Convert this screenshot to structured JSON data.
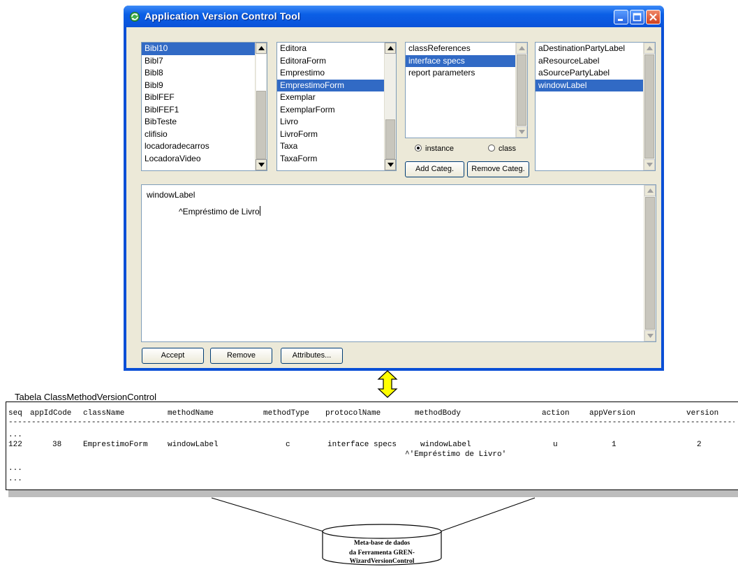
{
  "window": {
    "title": "Application Version Control Tool",
    "app_icon": "recycle-gear-icon",
    "controls": [
      "minimize-icon",
      "maximize-icon",
      "close-icon"
    ]
  },
  "lists": {
    "apps": {
      "items": [
        "Bibl10",
        "Bibl7",
        "Bibl8",
        "Bibl9",
        "BiblFEF",
        "BiblFEF1",
        "BibTeste",
        "clifisio",
        "locadoradecarros",
        "LocadoraVideo"
      ],
      "selected": "Bibl10"
    },
    "classes": {
      "items": [
        "Editora",
        "EditoraForm",
        "Emprestimo",
        "EmprestimoForm",
        "Exemplar",
        "ExemplarForm",
        "Livro",
        "LivroForm",
        "Taxa",
        "TaxaForm"
      ],
      "selected": "EmprestimoForm"
    },
    "categories": {
      "items": [
        "classReferences",
        "interface specs",
        "report parameters"
      ],
      "selected": "interface specs"
    },
    "methods": {
      "items": [
        "aDestinationPartyLabel",
        "aResourceLabel",
        "aSourcePartyLabel",
        "windowLabel"
      ],
      "selected": "windowLabel"
    }
  },
  "radios": {
    "instance_label": "instance",
    "class_label": "class",
    "selected": "instance"
  },
  "buttons": {
    "add_categ": "Add Categ.",
    "remove_categ": "Remove Categ.",
    "accept": "Accept",
    "remove": "Remove",
    "attributes": "Attributes..."
  },
  "editor": {
    "line1": "windowLabel",
    "line2": "^Empréstimo de Livro"
  },
  "table": {
    "caption": "Tabela ClassMethodVersionControl",
    "columns": [
      "seq",
      "appIdCode",
      "className",
      "methodName",
      "methodType",
      "protocolName",
      "methodBody",
      "action",
      "appVersion",
      "version"
    ],
    "separator": "-------------------------------------------------------------------------------------------------------------------------------------------------------------------",
    "ellipsis": "...",
    "row": {
      "seq": "122",
      "appIdCode": "38",
      "className": "EmprestimoForm",
      "methodName": "windowLabel",
      "methodType": "c",
      "protocolName": "interface specs",
      "methodBody_line1": "windowLabel",
      "methodBody_line2": "^'Empréstimo de Livro'",
      "action": "u",
      "appVersion": "1",
      "version": "2"
    }
  },
  "database": {
    "line1": "Meta-base de dados",
    "line2": "da Ferramenta GREN-",
    "line3": "WizardVersionControl"
  },
  "colors": {
    "title_bar": "#0a52d9",
    "selection": "#316ac5",
    "arrow_fill": "#ffff00"
  }
}
